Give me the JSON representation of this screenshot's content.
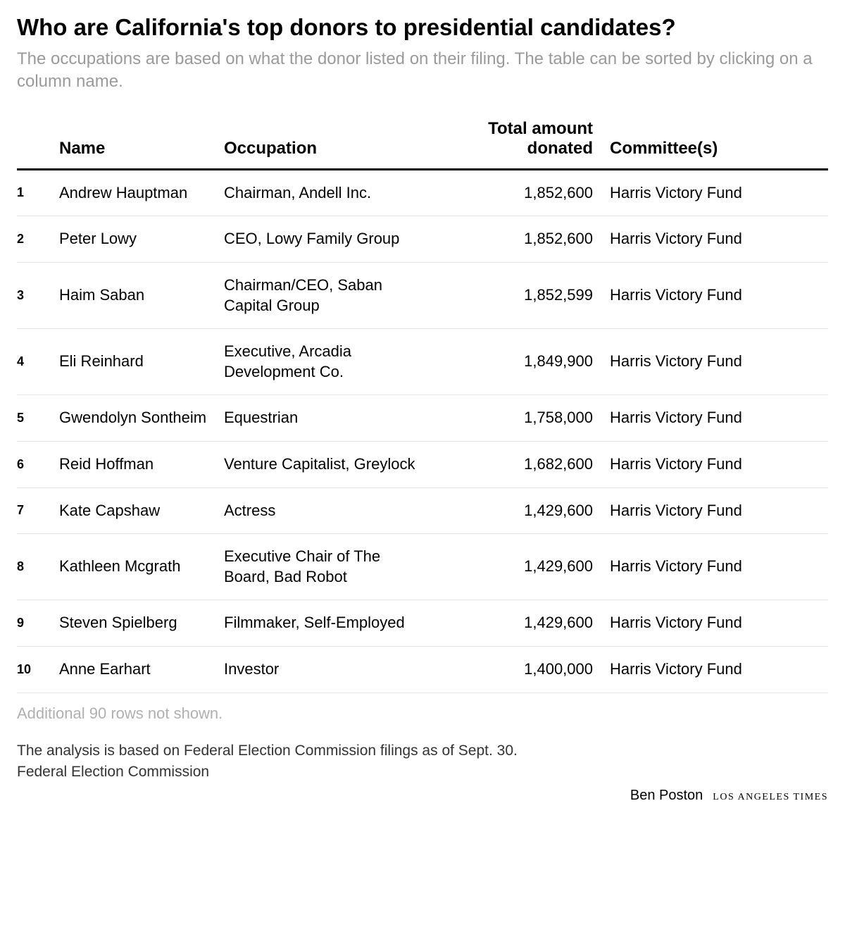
{
  "title": "Who are California's top donors to presidential candidates?",
  "subtitle": "The occupations are based on what the donor listed on their filing. The table can be sorted by clicking on a column name.",
  "columns": {
    "name": "Name",
    "occupation": "Occupation",
    "amount": "Total amount donated",
    "committee": "Committee(s)"
  },
  "rows": [
    {
      "rank": "1",
      "name": "Andrew Hauptman",
      "occupation": "Chairman, Andell Inc.",
      "amount": "1,852,600",
      "committee": "Harris Victory Fund"
    },
    {
      "rank": "2",
      "name": "Peter Lowy",
      "occupation": "CEO, Lowy Family Group",
      "amount": "1,852,600",
      "committee": "Harris Victory Fund"
    },
    {
      "rank": "3",
      "name": "Haim Saban",
      "occupation": "Chairman/CEO, Saban Capital Group",
      "amount": "1,852,599",
      "committee": "Harris Victory Fund"
    },
    {
      "rank": "4",
      "name": "Eli Reinhard",
      "occupation": "Executive, Arcadia Development Co.",
      "amount": "1,849,900",
      "committee": "Harris Victory Fund"
    },
    {
      "rank": "5",
      "name": "Gwendolyn Sontheim",
      "occupation": "Equestrian",
      "amount": "1,758,000",
      "committee": "Harris Victory Fund"
    },
    {
      "rank": "6",
      "name": "Reid Hoffman",
      "occupation": "Venture Capitalist, Greylock",
      "amount": "1,682,600",
      "committee": "Harris Victory Fund"
    },
    {
      "rank": "7",
      "name": "Kate Capshaw",
      "occupation": "Actress",
      "amount": "1,429,600",
      "committee": "Harris Victory Fund"
    },
    {
      "rank": "8",
      "name": "Kathleen Mcgrath",
      "occupation": "Executive Chair of The Board, Bad Robot",
      "amount": "1,429,600",
      "committee": "Harris Victory Fund"
    },
    {
      "rank": "9",
      "name": "Steven Spielberg",
      "occupation": "Filmmaker, Self-Employed",
      "amount": "1,429,600",
      "committee": "Harris Victory Fund"
    },
    {
      "rank": "10",
      "name": "Anne Earhart",
      "occupation": "Investor",
      "amount": "1,400,000",
      "committee": "Harris Victory Fund"
    }
  ],
  "truncated": "Additional 90 rows not shown.",
  "note": "The analysis is based on Federal Election Commission filings as of Sept. 30.",
  "source": "Federal Election Commission",
  "byline": "Ben Poston",
  "publication": "LOS ANGELES TIMES"
}
